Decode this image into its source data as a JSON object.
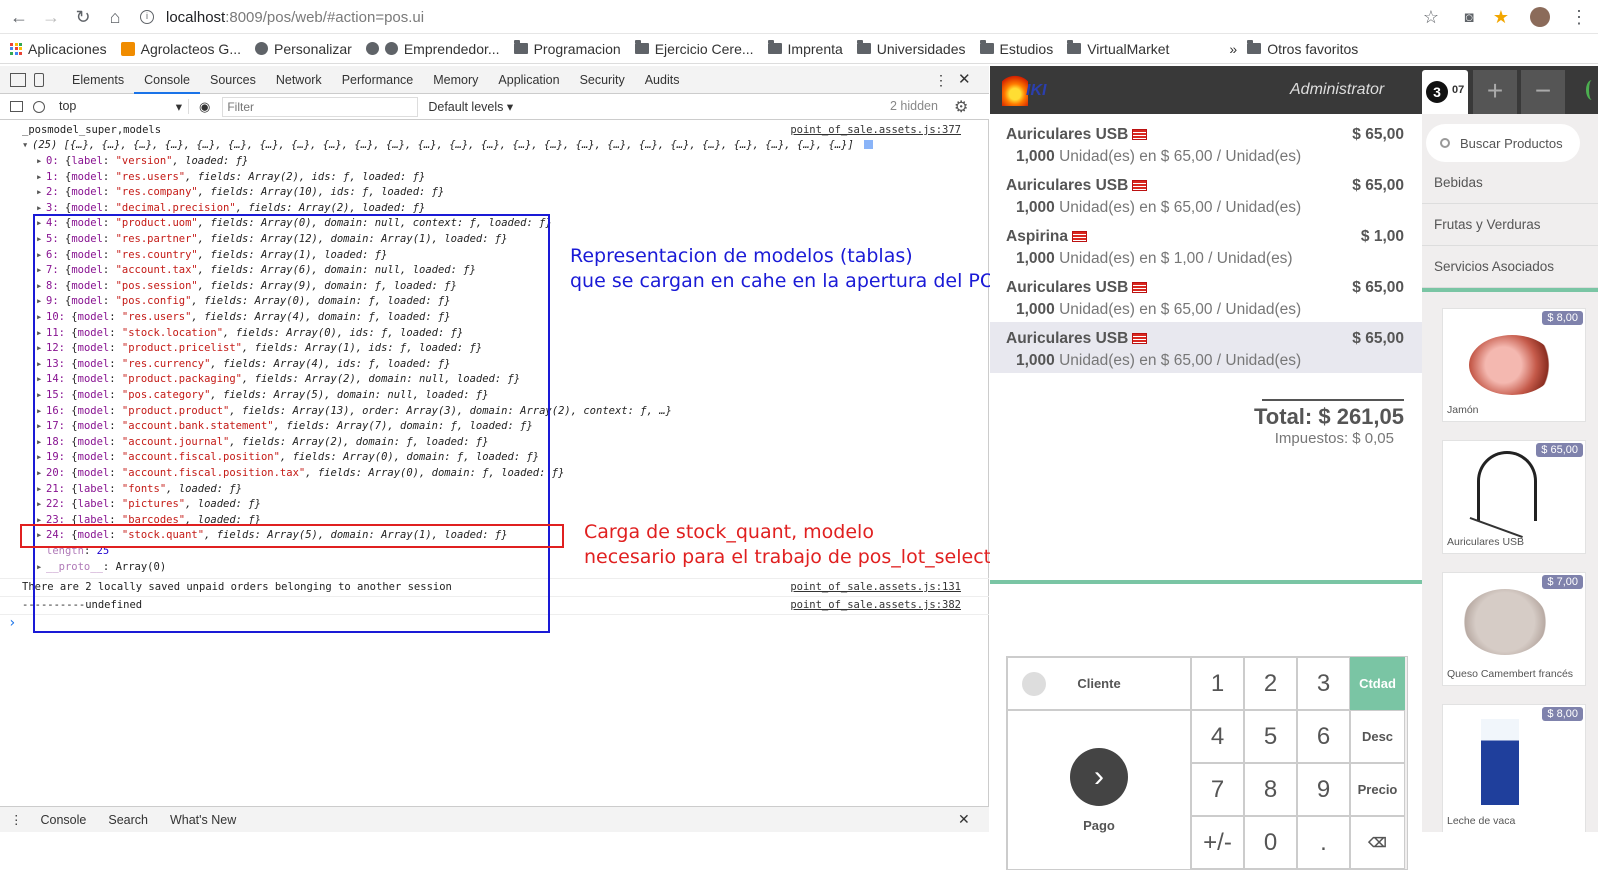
{
  "browser": {
    "url_host": "localhost",
    "url_rest": ":8009/pos/web/#action=pos.ui",
    "bookmarks": [
      "Aplicaciones",
      "Agrolacteos G...",
      "Personalizar",
      "Emprendedor...",
      "Programacion",
      "Ejercicio Cere...",
      "Imprenta",
      "Universidades",
      "Estudios",
      "VirtualMarket"
    ],
    "more_chevron": "»",
    "other_favorites": "Otros favoritos"
  },
  "devtools": {
    "tabs": [
      "Elements",
      "Console",
      "Sources",
      "Network",
      "Performance",
      "Memory",
      "Application",
      "Security",
      "Audits"
    ],
    "context": "top",
    "filter_placeholder": "Filter",
    "levels": "Default levels ▾",
    "hidden": "2 hidden",
    "drawer_tabs": [
      "Console",
      "Search",
      "What's New"
    ],
    "header_label": "_posmodel_super,models",
    "header_src": "point_of_sale.assets.js:377",
    "array_summary": "(25) [{…}, {…}, {…}, {…}, {…}, {…}, {…}, {…}, {…}, {…}, {…}, {…}, {…}, {…}, {…}, {…}, {…}, {…}, {…}, {…}, {…}, {…}, {…}, {…}, {…}]",
    "rows": [
      {
        "idx": "0:",
        "kind": "label",
        "name": "\"version\"",
        "rest": ", loaded: ƒ}"
      },
      {
        "idx": "1:",
        "kind": "model",
        "name": "\"res.users\"",
        "rest": ", fields: Array(2), ids: ƒ, loaded: ƒ}"
      },
      {
        "idx": "2:",
        "kind": "model",
        "name": "\"res.company\"",
        "rest": ", fields: Array(10), ids: ƒ, loaded: ƒ}"
      },
      {
        "idx": "3:",
        "kind": "model",
        "name": "\"decimal.precision\"",
        "rest": ", fields: Array(2), loaded: ƒ}"
      },
      {
        "idx": "4:",
        "kind": "model",
        "name": "\"product.uom\"",
        "rest": ", fields: Array(0), domain: null, context: ƒ, loaded: ƒ}"
      },
      {
        "idx": "5:",
        "kind": "model",
        "name": "\"res.partner\"",
        "rest": ", fields: Array(12), domain: Array(1), loaded: ƒ}"
      },
      {
        "idx": "6:",
        "kind": "model",
        "name": "\"res.country\"",
        "rest": ", fields: Array(1), loaded: ƒ}"
      },
      {
        "idx": "7:",
        "kind": "model",
        "name": "\"account.tax\"",
        "rest": ", fields: Array(6), domain: null, loaded: ƒ}"
      },
      {
        "idx": "8:",
        "kind": "model",
        "name": "\"pos.session\"",
        "rest": ", fields: Array(9), domain: ƒ, loaded: ƒ}"
      },
      {
        "idx": "9:",
        "kind": "model",
        "name": "\"pos.config\"",
        "rest": ", fields: Array(0), domain: ƒ, loaded: ƒ}"
      },
      {
        "idx": "10:",
        "kind": "model",
        "name": "\"res.users\"",
        "rest": ", fields: Array(4), domain: ƒ, loaded: ƒ}"
      },
      {
        "idx": "11:",
        "kind": "model",
        "name": "\"stock.location\"",
        "rest": ", fields: Array(0), ids: ƒ, loaded: ƒ}"
      },
      {
        "idx": "12:",
        "kind": "model",
        "name": "\"product.pricelist\"",
        "rest": ", fields: Array(1), ids: ƒ, loaded: ƒ}"
      },
      {
        "idx": "13:",
        "kind": "model",
        "name": "\"res.currency\"",
        "rest": ", fields: Array(4), ids: ƒ, loaded: ƒ}"
      },
      {
        "idx": "14:",
        "kind": "model",
        "name": "\"product.packaging\"",
        "rest": ", fields: Array(2), domain: null, loaded: ƒ}"
      },
      {
        "idx": "15:",
        "kind": "model",
        "name": "\"pos.category\"",
        "rest": ", fields: Array(5), domain: null, loaded: ƒ}"
      },
      {
        "idx": "16:",
        "kind": "model",
        "name": "\"product.product\"",
        "rest": ", fields: Array(13), order: Array(3), domain: Array(2), context: ƒ, …}"
      },
      {
        "idx": "17:",
        "kind": "model",
        "name": "\"account.bank.statement\"",
        "rest": ", fields: Array(7), domain: ƒ, loaded: ƒ}"
      },
      {
        "idx": "18:",
        "kind": "model",
        "name": "\"account.journal\"",
        "rest": ", fields: Array(2), domain: ƒ, loaded: ƒ}"
      },
      {
        "idx": "19:",
        "kind": "model",
        "name": "\"account.fiscal.position\"",
        "rest": ", fields: Array(0), domain: ƒ, loaded: ƒ}"
      },
      {
        "idx": "20:",
        "kind": "model",
        "name": "\"account.fiscal.position.tax\"",
        "rest": ", fields: Array(0), domain: ƒ, loaded: ƒ}"
      },
      {
        "idx": "21:",
        "kind": "label",
        "name": "\"fonts\"",
        "rest": ", loaded: ƒ}"
      },
      {
        "idx": "22:",
        "kind": "label",
        "name": "\"pictures\"",
        "rest": ", loaded: ƒ}"
      },
      {
        "idx": "23:",
        "kind": "label",
        "name": "\"barcodes\"",
        "rest": ", loaded: ƒ}"
      },
      {
        "idx": "24:",
        "kind": "model",
        "name": "\"stock.quant\"",
        "rest": ", fields: Array(5), domain: Array(1), loaded: ƒ}"
      }
    ],
    "length_key": "length",
    "length_val": "25",
    "proto_key": "__proto__",
    "proto_val": "Array(0)",
    "msg1": "There are 2 locally saved unpaid orders belonging to another session",
    "msg1_src": "point_of_sale.assets.js:131",
    "msg2": "----------undefined",
    "msg2_src": "point_of_sale.assets.js:382",
    "prompt": "›"
  },
  "annotations": {
    "blue_line1": "Representacion de modelos (tablas)",
    "blue_line2": "que se cargan en cahe en la apertura del  POS",
    "red_line1": "Carga de stock_quant, modelo",
    "red_line2": "necesario para el trabajo de pos_lot_selection",
    "blue_color": "#1a1ad6",
    "red_color": "#e02020"
  },
  "pos": {
    "logo_text": "IKI",
    "user": "Administrator",
    "order_count": "3",
    "order_ref": "07",
    "add_order": "+",
    "remove_order": "−",
    "search_placeholder": "Buscar Productos",
    "categories": [
      "Bebidas",
      "Frutas y Verduras",
      "Servicios Asociados"
    ],
    "order_lines": [
      {
        "name": "Auriculares USB",
        "price": "$ 65,00",
        "qty": "1,000",
        "unit": " Unidad(es) en $ 65,00 / Unidad(es)"
      },
      {
        "name": "Auriculares USB",
        "price": "$ 65,00",
        "qty": "1,000",
        "unit": " Unidad(es) en $ 65,00 / Unidad(es)"
      },
      {
        "name": "Aspirina",
        "price": "$ 1,00",
        "qty": "1,000",
        "unit": " Unidad(es) en $ 1,00 / Unidad(es)"
      },
      {
        "name": "Auriculares USB",
        "price": "$ 65,00",
        "qty": "1,000",
        "unit": " Unidad(es) en $ 65,00 / Unidad(es)"
      },
      {
        "name": "Auriculares USB",
        "price": "$ 65,00",
        "qty": "1,000",
        "unit": " Unidad(es) en $ 65,00 / Unidad(es)"
      }
    ],
    "total": "Total: $ 261,05",
    "taxes": "Impuestos: $ 0,05",
    "customer": "Cliente",
    "payment": "Pago",
    "keys": [
      "1",
      "2",
      "3",
      "Ctdad",
      "4",
      "5",
      "6",
      "Desc",
      "7",
      "8",
      "9",
      "Precio",
      "+/-",
      "0",
      ".",
      "⌫"
    ],
    "products": [
      {
        "name": "Jamón",
        "price": "$ 8,00"
      },
      {
        "name": "Auriculares USB",
        "price": "$ 65,00"
      },
      {
        "name": "Queso Camembert francés",
        "price": "$ 7,00"
      },
      {
        "name": "Leche de vaca",
        "price": "$ 8,00"
      }
    ],
    "accent": "#7ac5a4"
  }
}
